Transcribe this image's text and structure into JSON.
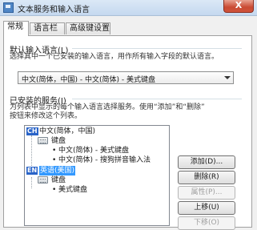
{
  "window": {
    "title": "文本服务和输入语言",
    "close_glyph": "X"
  },
  "tabs": [
    {
      "label": "常规",
      "active": true
    },
    {
      "label": "语言栏",
      "active": false
    },
    {
      "label": "高级键设置",
      "active": false
    }
  ],
  "default_input": {
    "title": "默认输入语言(L)",
    "description": "选择其中一个已安装的输入语言，用作所有输入字段的默认语言。",
    "selected": "中文(简体，中国) - 中文(简体) - 美式键盘"
  },
  "installed_services": {
    "title": "已安装的服务(I)",
    "description_line1": "为列表中显示的每个输入语言选择服务。使用“添加”和“删除”",
    "description_line2": "按钮来修改这个列表。",
    "tree": {
      "lang1": {
        "badge": "CH",
        "label": "中文(简体，中国)"
      },
      "lang1_keyboard": "键盘",
      "lang1_item1": "中文(简体) - 美式键盘",
      "lang1_item2": "中文(简体) - 搜狗拼音输入法",
      "lang2": {
        "badge": "EN",
        "label": "英语(美国)"
      },
      "lang2_keyboard": "键盘",
      "lang2_item1": "美式键盘",
      "bullet": "•"
    },
    "buttons": {
      "add": "添加(D)...",
      "remove": "删除(R)",
      "properties": "属性(P)...",
      "move_up": "上移(U)",
      "move_down": "下移(O)"
    }
  },
  "icons": {
    "app": "text-services-icon",
    "keyboard": "keyboard-icon",
    "dropdown": "chevron-down-icon"
  }
}
